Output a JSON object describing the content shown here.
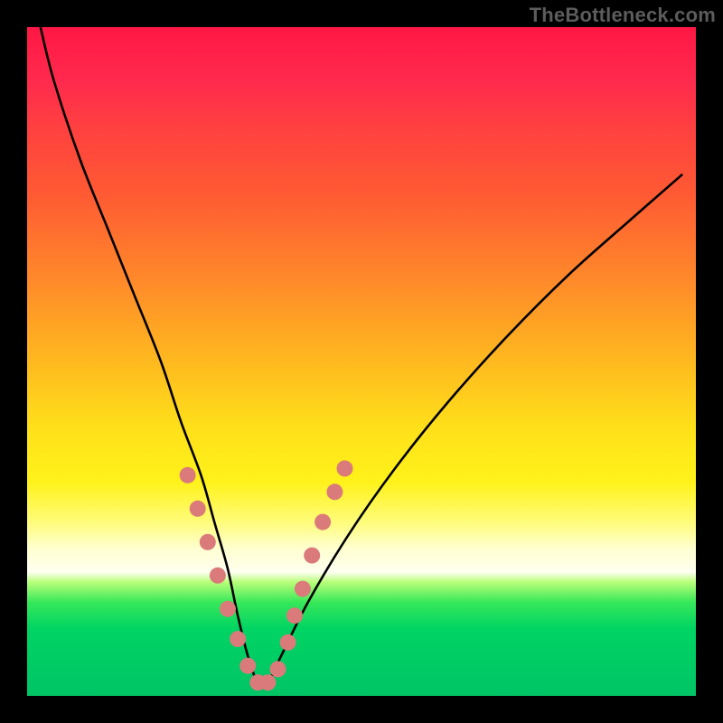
{
  "watermark": "TheBottleneck.com",
  "chart_data": {
    "type": "line",
    "title": "",
    "xlabel": "",
    "ylabel": "",
    "xlim": [
      0,
      100
    ],
    "ylim": [
      0,
      100
    ],
    "grid": false,
    "background": "red-to-green vertical gradient",
    "series": [
      {
        "name": "V-curve",
        "x": [
          2,
          4,
          8,
          12,
          16,
          20,
          23,
          26,
          28,
          30,
          31.5,
          33,
          34.5,
          36,
          38,
          42,
          48,
          55,
          63,
          72,
          81,
          90,
          98
        ],
        "y": [
          100,
          92,
          80,
          70,
          60,
          50,
          41,
          33,
          26,
          19,
          12,
          6,
          2,
          2,
          6,
          14,
          24,
          34,
          44,
          54,
          63,
          71,
          78
        ]
      }
    ],
    "highlighted_points": {
      "name": "dots",
      "color": "#db7a7a",
      "x": [
        24.0,
        25.5,
        27.0,
        28.5,
        30.0,
        31.5,
        33.0,
        34.5,
        36.0,
        37.5,
        39.0,
        40.0,
        41.2,
        42.6,
        44.2,
        46.0,
        47.5
      ],
      "y": [
        33.0,
        28.0,
        23.0,
        18.0,
        13.0,
        8.5,
        4.5,
        2.0,
        2.0,
        4.0,
        8.0,
        12.0,
        16.0,
        21.0,
        26.0,
        30.5,
        34.0
      ]
    }
  }
}
